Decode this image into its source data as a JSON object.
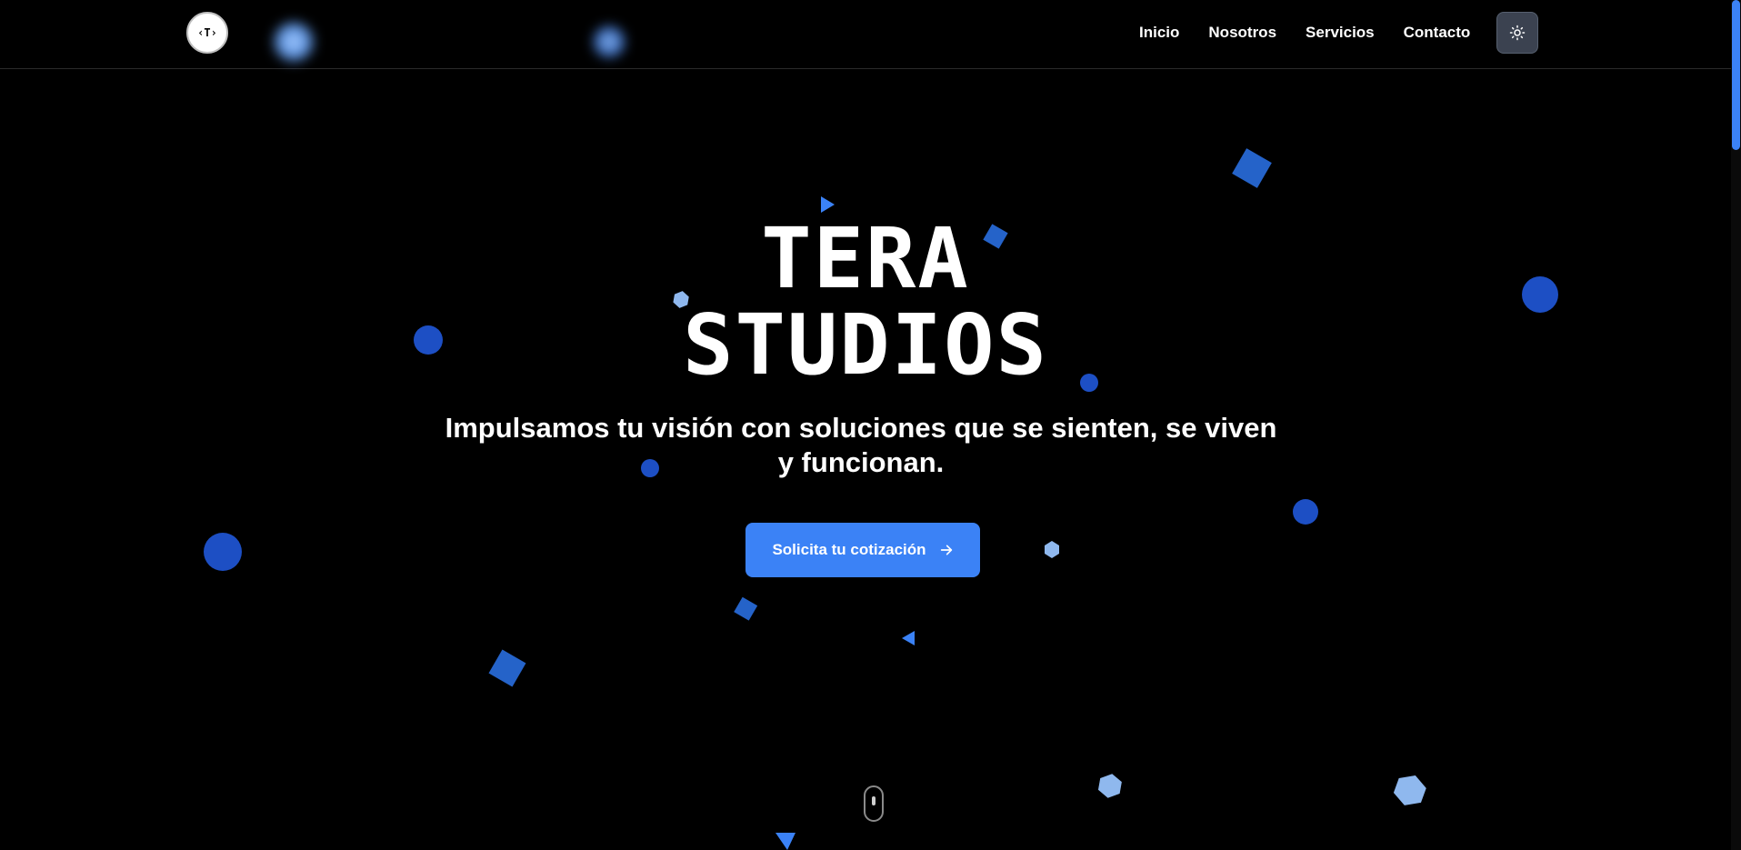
{
  "header": {
    "logo_text": "‹T›",
    "nav": [
      {
        "label": "Inicio"
      },
      {
        "label": "Nosotros"
      },
      {
        "label": "Servicios"
      },
      {
        "label": "Contacto"
      }
    ],
    "theme_toggle_icon": "sun-icon"
  },
  "hero": {
    "title_line1": "TERA",
    "title_line2": "STUDIOS",
    "subtitle": "Impulsamos tu visión con soluciones que se sienten, se viven y funcionan.",
    "cta_label": "Solicita tu cotización",
    "cta_icon": "arrow-right-icon",
    "scroll_icon": "mouse-scroll-icon"
  },
  "colors": {
    "background": "#000000",
    "accent": "#3b82f6",
    "shape_dark": "#1d4fc4",
    "shape_mid": "#2563c9",
    "shape_light": "#8fb8ee"
  }
}
